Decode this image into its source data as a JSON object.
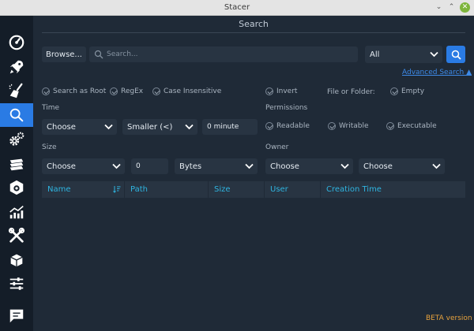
{
  "window": {
    "title": "Stacer"
  },
  "sidebar": {
    "items": [
      {
        "name": "dashboard",
        "icon": "speedometer-icon"
      },
      {
        "name": "startup-apps",
        "icon": "rocket-icon"
      },
      {
        "name": "system-cleaner",
        "icon": "broom-icon"
      },
      {
        "name": "search",
        "icon": "search-icon",
        "active": true
      },
      {
        "name": "services",
        "icon": "gears-icon"
      },
      {
        "name": "processes",
        "icon": "processor-icon"
      },
      {
        "name": "uninstaller",
        "icon": "package-icon"
      },
      {
        "name": "resources",
        "icon": "chart-icon"
      },
      {
        "name": "helpers",
        "icon": "tools-icon"
      },
      {
        "name": "apt-repository",
        "icon": "box-icon"
      },
      {
        "name": "settings",
        "icon": "sliders-icon"
      },
      {
        "name": "feedback",
        "icon": "message-icon"
      }
    ]
  },
  "page": {
    "title": "Search"
  },
  "search": {
    "browse_label": "Browse...",
    "placeholder": "Search...",
    "scope": "All",
    "advanced_label": "Advanced Search ▲"
  },
  "options": {
    "search_as_root": "Search as Root",
    "regex": "RegEx",
    "case_insensitive": "Case Insensitive",
    "invert": "Invert",
    "file_or_folder_label": "File or Folder:",
    "empty": "Empty"
  },
  "time": {
    "label": "Time",
    "choose": "Choose",
    "comparison": "Smaller (<)",
    "value": "0 minute"
  },
  "permissions": {
    "label": "Permissions",
    "readable": "Readable",
    "writable": "Writable",
    "executable": "Executable"
  },
  "size": {
    "label": "Size",
    "choose": "Choose",
    "value": "0",
    "unit": "Bytes"
  },
  "owner": {
    "label": "Owner",
    "user": "Choose",
    "group": "Choose"
  },
  "table": {
    "columns": [
      "Name",
      "Path",
      "Size",
      "User",
      "Creation Time"
    ]
  },
  "footer": {
    "version": "BETA version"
  },
  "colors": {
    "accent": "#2a7be4",
    "background": "#1f2a37",
    "sidebar": "#141d28",
    "header_text": "#2fb4e0",
    "beta": "#e8a33d"
  }
}
